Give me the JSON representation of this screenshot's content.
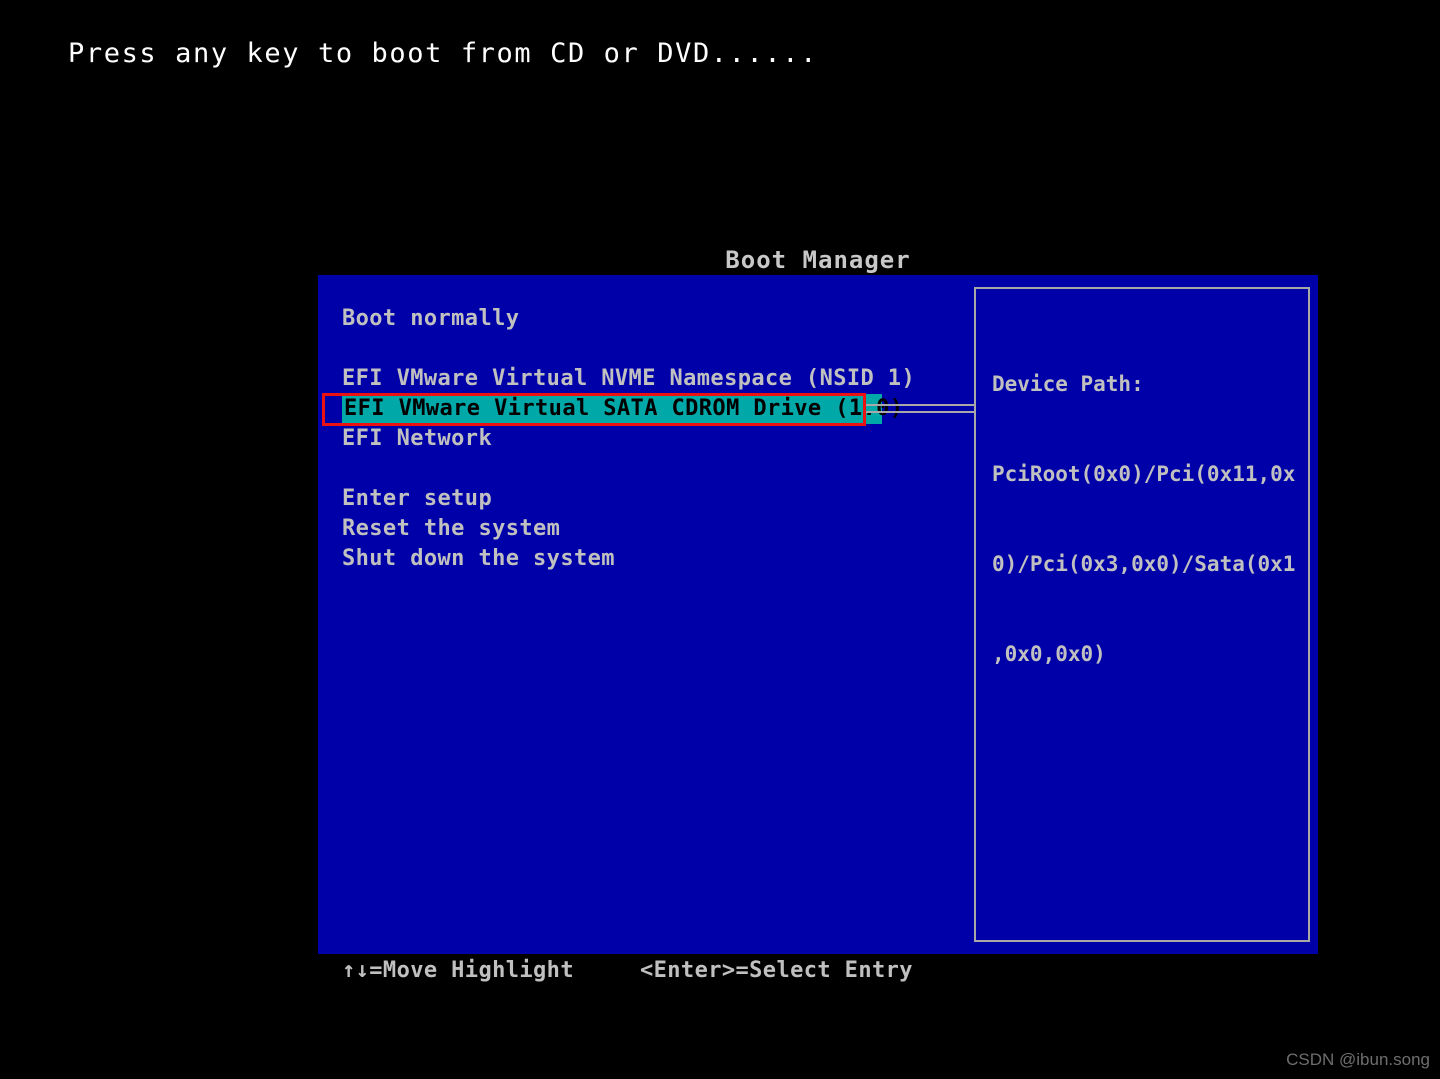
{
  "screen": {
    "background_color": "#000000",
    "boot_prompt": "Press any key to boot from CD or DVD......"
  },
  "boot_manager": {
    "title": "Boot Manager",
    "panel_color": "#0000a8",
    "text_color": "#c0c0c0",
    "highlight_color": "#00a8a8",
    "highlight_text_color": "#000000",
    "menu": [
      {
        "label": "Boot normally",
        "selected": false
      },
      {
        "label": "",
        "selected": false
      },
      {
        "label": "EFI VMware Virtual NVME Namespace (NSID 1)",
        "selected": false
      },
      {
        "label": "EFI VMware Virtual SATA CDROM Drive (1.0)",
        "selected": true
      },
      {
        "label": "EFI Network",
        "selected": false
      },
      {
        "label": "",
        "selected": false
      },
      {
        "label": "Enter setup",
        "selected": false
      },
      {
        "label": "Reset the system",
        "selected": false
      },
      {
        "label": "Shut down the system",
        "selected": false
      }
    ],
    "info_panel": {
      "lines": [
        "Device Path:",
        "PciRoot(0x0)/Pci(0x11,0x",
        "0)/Pci(0x3,0x0)/Sata(0x1",
        ",0x0,0x0)"
      ]
    },
    "footer": {
      "move_hint": "↑↓=Move Highlight",
      "select_hint": "<Enter>=Select Entry"
    }
  },
  "annotation": {
    "color": "#ee1111",
    "target": "EFI VMware Virtual SATA CDROM Drive (1.0)"
  },
  "watermark": {
    "text": "CSDN @ibun.song"
  }
}
